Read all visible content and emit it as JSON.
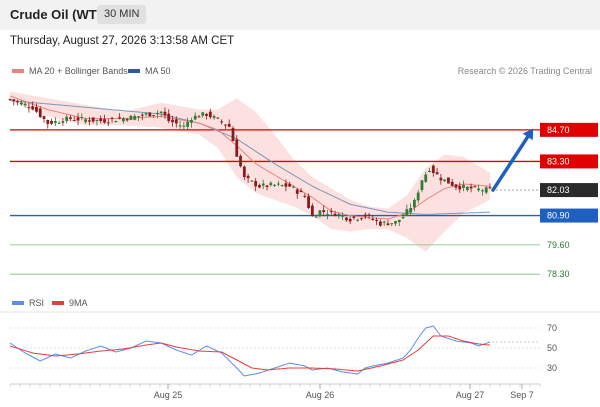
{
  "header": {
    "instrument": "Crude Oil (WTI)",
    "timeframe": "30 MIN",
    "datetime": "Thursday, August 27, 2026 3:13:58 AM CET"
  },
  "legend": {
    "ma20": "MA 20 + Bollinger Bands",
    "ma50": "MA 50",
    "copyright": "Research © 2026 Trading Central",
    "rsi": "RSI",
    "rsi_ma": "9MA"
  },
  "colors": {
    "up": "#2e7d32",
    "down": "#8b1a1a",
    "resistance": "#e00000",
    "support": "#1f5fbf",
    "target": "#1f5fbf",
    "ma50": "#7d96b8",
    "ma20": "#f08080",
    "bands": "#fde0e0",
    "rsi": "#5b8fe8",
    "rsi_ma": "#e04040"
  },
  "chart_data": {
    "type": "candlestick",
    "x_ticks": [
      "Aug 25",
      "Aug 26",
      "Aug 27",
      "Sep 7"
    ],
    "current_price": "82.03",
    "levels": [
      {
        "label": "84.70",
        "value": 84.7,
        "kind": "resistance"
      },
      {
        "label": "83.30",
        "value": 83.3,
        "kind": "resistance"
      },
      {
        "label": "80.90",
        "value": 80.9,
        "kind": "support"
      },
      {
        "label": "79.60",
        "value": 79.6,
        "kind": "minor"
      },
      {
        "label": "78.30",
        "value": 78.3,
        "kind": "minor"
      }
    ],
    "price_path": [
      [
        0,
        86.05
      ],
      [
        6,
        85.7
      ],
      [
        10,
        85.0
      ],
      [
        16,
        85.2
      ],
      [
        24,
        85.1
      ],
      [
        32,
        85.25
      ],
      [
        40,
        85.5
      ],
      [
        42,
        85.1
      ],
      [
        46,
        84.85
      ],
      [
        48,
        85.25
      ],
      [
        52,
        85.4
      ],
      [
        56,
        85.05
      ],
      [
        58,
        84.85
      ],
      [
        60,
        83.6
      ],
      [
        62,
        82.55
      ],
      [
        66,
        82.2
      ],
      [
        70,
        82.25
      ],
      [
        74,
        82.2
      ],
      [
        78,
        81.75
      ],
      [
        80,
        80.85
      ],
      [
        82,
        81.1
      ],
      [
        86,
        81.0
      ],
      [
        90,
        80.75
      ],
      [
        94,
        80.9
      ],
      [
        98,
        80.55
      ],
      [
        102,
        80.6
      ],
      [
        104,
        80.85
      ],
      [
        107,
        81.5
      ],
      [
        109,
        82.5
      ],
      [
        111,
        83.0
      ],
      [
        114,
        82.55
      ],
      [
        118,
        82.2
      ],
      [
        124,
        82.05
      ],
      [
        127,
        82.03
      ]
    ],
    "ma50_path": [
      [
        0,
        86.0
      ],
      [
        20,
        85.7
      ],
      [
        40,
        85.4
      ],
      [
        50,
        85.0
      ],
      [
        60,
        84.3
      ],
      [
        70,
        83.2
      ],
      [
        80,
        82.2
      ],
      [
        90,
        81.4
      ],
      [
        100,
        81.05
      ],
      [
        110,
        80.95
      ],
      [
        127,
        81.05
      ]
    ],
    "ma20_path": [
      [
        0,
        86.2
      ],
      [
        10,
        85.6
      ],
      [
        20,
        85.2
      ],
      [
        30,
        85.2
      ],
      [
        40,
        85.3
      ],
      [
        50,
        85.0
      ],
      [
        55,
        84.7
      ],
      [
        60,
        84.0
      ],
      [
        65,
        83.2
      ],
      [
        70,
        82.7
      ],
      [
        75,
        82.2
      ],
      [
        80,
        81.7
      ],
      [
        85,
        81.1
      ],
      [
        90,
        80.9
      ],
      [
        95,
        80.8
      ],
      [
        100,
        80.75
      ],
      [
        105,
        81.0
      ],
      [
        110,
        81.6
      ],
      [
        115,
        82.1
      ],
      [
        120,
        82.3
      ],
      [
        127,
        82.2
      ]
    ],
    "bollinger_upper": [
      [
        0,
        86.4
      ],
      [
        10,
        86.1
      ],
      [
        20,
        85.8
      ],
      [
        30,
        85.5
      ],
      [
        40,
        85.9
      ],
      [
        50,
        85.6
      ],
      [
        55,
        85.6
      ],
      [
        60,
        86.1
      ],
      [
        65,
        85.5
      ],
      [
        70,
        84.5
      ],
      [
        75,
        83.4
      ],
      [
        80,
        82.6
      ],
      [
        85,
        82.1
      ],
      [
        90,
        81.6
      ],
      [
        95,
        81.3
      ],
      [
        100,
        81.2
      ],
      [
        105,
        81.8
      ],
      [
        110,
        83.0
      ],
      [
        115,
        83.6
      ],
      [
        120,
        83.5
      ],
      [
        127,
        82.8
      ]
    ],
    "bollinger_lower": [
      [
        0,
        86.0
      ],
      [
        10,
        85.3
      ],
      [
        20,
        84.9
      ],
      [
        30,
        84.9
      ],
      [
        40,
        84.8
      ],
      [
        50,
        84.5
      ],
      [
        55,
        83.9
      ],
      [
        60,
        82.6
      ],
      [
        65,
        81.9
      ],
      [
        70,
        81.6
      ],
      [
        75,
        81.3
      ],
      [
        80,
        80.9
      ],
      [
        85,
        80.3
      ],
      [
        90,
        80.2
      ],
      [
        95,
        80.3
      ],
      [
        100,
        80.3
      ],
      [
        105,
        79.9
      ],
      [
        110,
        79.3
      ],
      [
        115,
        80.2
      ],
      [
        120,
        81.0
      ],
      [
        127,
        81.6
      ]
    ],
    "rsi": {
      "ticks": [
        70,
        50,
        30
      ],
      "values_path": [
        [
          0,
          55
        ],
        [
          4,
          45
        ],
        [
          8,
          37
        ],
        [
          12,
          44
        ],
        [
          16,
          40
        ],
        [
          20,
          47
        ],
        [
          24,
          52
        ],
        [
          28,
          46
        ],
        [
          32,
          50
        ],
        [
          36,
          57
        ],
        [
          40,
          55
        ],
        [
          44,
          48
        ],
        [
          48,
          43
        ],
        [
          52,
          52
        ],
        [
          56,
          45
        ],
        [
          60,
          30
        ],
        [
          62,
          22
        ],
        [
          66,
          25
        ],
        [
          70,
          30
        ],
        [
          74,
          35
        ],
        [
          78,
          32
        ],
        [
          80,
          28
        ],
        [
          84,
          30
        ],
        [
          88,
          26
        ],
        [
          92,
          24
        ],
        [
          94,
          30
        ],
        [
          96,
          32
        ],
        [
          100,
          35
        ],
        [
          104,
          40
        ],
        [
          106,
          48
        ],
        [
          108,
          60
        ],
        [
          110,
          70
        ],
        [
          112,
          72
        ],
        [
          114,
          62
        ],
        [
          118,
          57
        ],
        [
          122,
          55
        ],
        [
          124,
          52
        ],
        [
          127,
          56
        ]
      ],
      "ma9_path": [
        [
          0,
          52
        ],
        [
          6,
          45
        ],
        [
          12,
          42
        ],
        [
          18,
          44
        ],
        [
          24,
          47
        ],
        [
          30,
          49
        ],
        [
          36,
          53
        ],
        [
          40,
          55
        ],
        [
          44,
          51
        ],
        [
          50,
          47
        ],
        [
          56,
          46
        ],
        [
          60,
          38
        ],
        [
          64,
          30
        ],
        [
          68,
          28
        ],
        [
          74,
          30
        ],
        [
          80,
          30
        ],
        [
          86,
          29
        ],
        [
          92,
          27
        ],
        [
          98,
          32
        ],
        [
          104,
          38
        ],
        [
          108,
          48
        ],
        [
          112,
          62
        ],
        [
          116,
          62
        ],
        [
          120,
          57
        ],
        [
          124,
          54
        ],
        [
          127,
          53
        ]
      ]
    }
  }
}
